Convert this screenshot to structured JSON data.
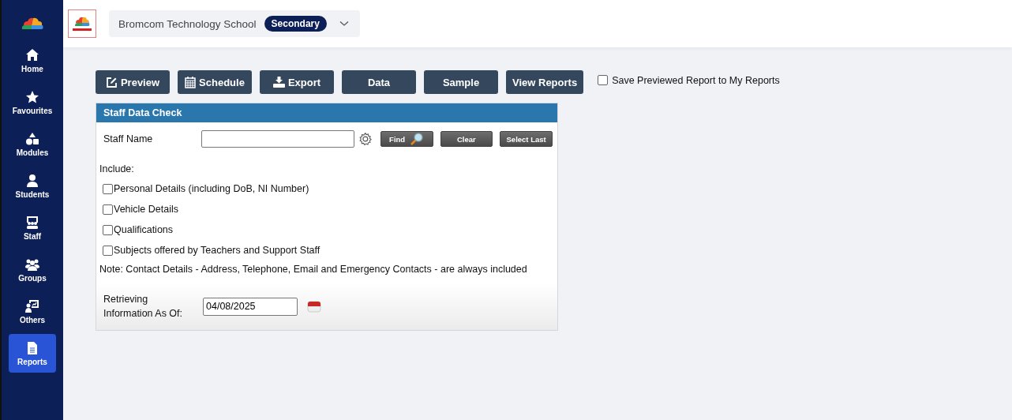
{
  "sidebar": {
    "items": [
      {
        "label": "Home",
        "selected": false
      },
      {
        "label": "Favourites",
        "selected": false
      },
      {
        "label": "Modules",
        "selected": false
      },
      {
        "label": "Students",
        "selected": false
      },
      {
        "label": "Staff",
        "selected": false
      },
      {
        "label": "Groups",
        "selected": false
      },
      {
        "label": "Others",
        "selected": false
      },
      {
        "label": "Reports",
        "selected": true
      }
    ]
  },
  "header": {
    "school": "Bromcom Technology School",
    "badge": "Secondary"
  },
  "toolbar": {
    "buttons": [
      "Preview",
      "Schedule",
      "Export",
      "Data",
      "Sample",
      "View Reports"
    ],
    "save_option": {
      "label": "Save Previewed Report to My Reports",
      "checked": false
    }
  },
  "form": {
    "title": "Staff Data Check",
    "staff_name": {
      "label": "Staff Name"
    },
    "actions": [
      "Find",
      "Clear",
      "Select Last"
    ],
    "include_label": "Include:",
    "options": [
      {
        "label": "Personal Details (including DoB, NI Number)",
        "checked": false
      },
      {
        "label": "Vehicle Details",
        "checked": false
      },
      {
        "label": "Qualifications",
        "checked": false
      },
      {
        "label": "Subjects offered by Teachers and Support Staff",
        "checked": false
      }
    ],
    "note": "Note: Contact Details - Address, Telephone, Email and Emergency Contacts - are always included",
    "date": {
      "label": "Retrieving Information As Of:",
      "value": "04/08/2025"
    }
  }
}
